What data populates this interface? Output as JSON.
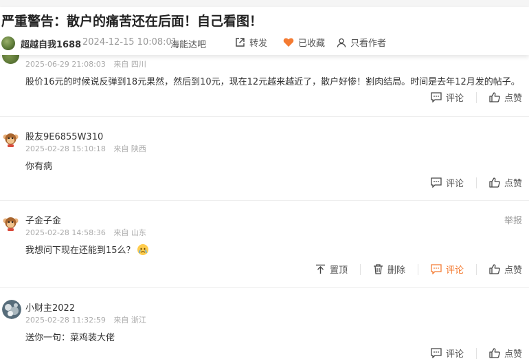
{
  "post": {
    "title": "严重警告：散户的痛苦还在后面！自己看图！",
    "author": "超越自我1688",
    "time": "2024-12-15 10:08:01",
    "forum": "海能达吧",
    "share_label": "转发",
    "favorite_label": "已收藏",
    "only_author_label": "只看作者"
  },
  "colors": {
    "accent": "#f47b32",
    "muted": "#aaaaaa",
    "text": "#333333"
  },
  "comments": [
    {
      "time": "2025-06-29 21:08:03",
      "location": "来自 四川",
      "text": "股价16元的时候说反弹到18元果然，然后到10元，现在12元越来越近了，散户好惨！割肉结局。时间是去年12月发的帖子。",
      "comment_label": "评论",
      "like_label": "点赞"
    },
    {
      "user": "股友9E6855W310",
      "time": "2025-02-28 15:10:18",
      "location": "来自 陕西",
      "text": "你有病",
      "comment_label": "评论",
      "like_label": "点赞"
    },
    {
      "user": "子金子金",
      "time": "2025-02-28 14:58:36",
      "location": "来自 山东",
      "text": "我想问下现在还能到15么？",
      "report_label": "举报",
      "pin_label": "置顶",
      "delete_label": "删除",
      "comment_label": "评论",
      "like_label": "点赞"
    },
    {
      "user": "小财主2022",
      "time": "2025-02-28 11:32:59",
      "location": "来自 浙江",
      "text": "送你一句：菜鸡装大佬",
      "comment_label": "评论",
      "like_label": "点赞"
    }
  ]
}
